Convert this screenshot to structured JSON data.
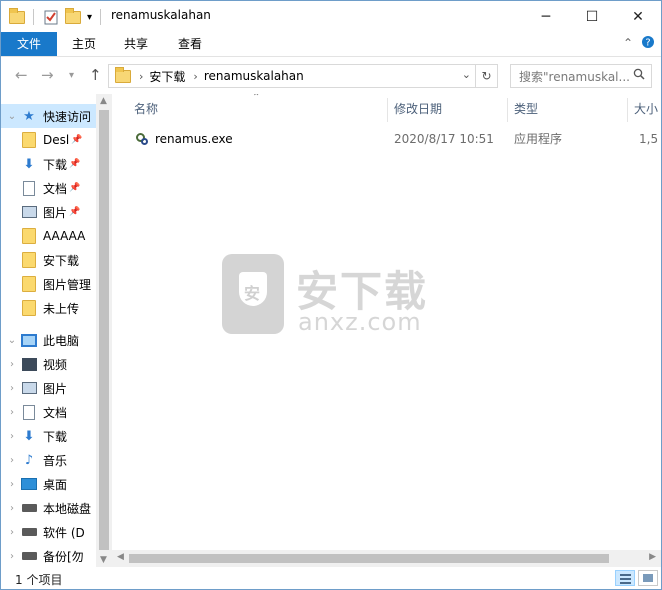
{
  "window": {
    "title": "renamuskalahan",
    "controls": {
      "minimize": "─",
      "maximize": "☐",
      "close": "✕"
    }
  },
  "ribbon": {
    "tabs": [
      "文件",
      "主页",
      "共享",
      "查看"
    ],
    "collapse_icon": "chevron-up-icon",
    "help_icon": "help-icon"
  },
  "address": {
    "breadcrumb": [
      "安下载",
      "renamuskalahan"
    ],
    "search_placeholder": "搜索\"renamuskal..."
  },
  "nav": {
    "quick_access": "快速访问",
    "quick_items": [
      {
        "label": "Desl",
        "icon": "folder-icon",
        "pinned": true
      },
      {
        "label": "下载",
        "icon": "download-icon",
        "pinned": true
      },
      {
        "label": "文档",
        "icon": "document-icon",
        "pinned": true
      },
      {
        "label": "图片",
        "icon": "picture-icon",
        "pinned": true
      },
      {
        "label": "AAAAA",
        "icon": "folder-icon",
        "pinned": false
      },
      {
        "label": "安下载",
        "icon": "folder-icon",
        "pinned": false
      },
      {
        "label": "图片管理",
        "icon": "folder-icon",
        "pinned": false
      },
      {
        "label": "未上传",
        "icon": "folder-icon",
        "pinned": false
      }
    ],
    "this_pc": "此电脑",
    "pc_items": [
      {
        "label": "视频",
        "icon": "video-icon"
      },
      {
        "label": "图片",
        "icon": "picture-icon"
      },
      {
        "label": "文档",
        "icon": "document-icon"
      },
      {
        "label": "下载",
        "icon": "download-icon"
      },
      {
        "label": "音乐",
        "icon": "music-icon"
      },
      {
        "label": "桌面",
        "icon": "desktop-icon"
      },
      {
        "label": "本地磁盘",
        "icon": "local-disk-icon"
      },
      {
        "label": "软件 (D",
        "icon": "drive-icon"
      },
      {
        "label": "备份[勿",
        "icon": "drive-icon"
      }
    ]
  },
  "columns": [
    "名称",
    "修改日期",
    "类型",
    "大小"
  ],
  "files": [
    {
      "name": "renamus.exe",
      "modified": "2020/8/17 10:51",
      "type": "应用程序",
      "size": "1,5"
    }
  ],
  "watermark": {
    "big": "安下载",
    "small": "anxz.com",
    "shield_char": "安"
  },
  "status": {
    "count": "1 个项目"
  },
  "colors": {
    "accent": "#1979ca",
    "selection": "#cce8ff"
  }
}
